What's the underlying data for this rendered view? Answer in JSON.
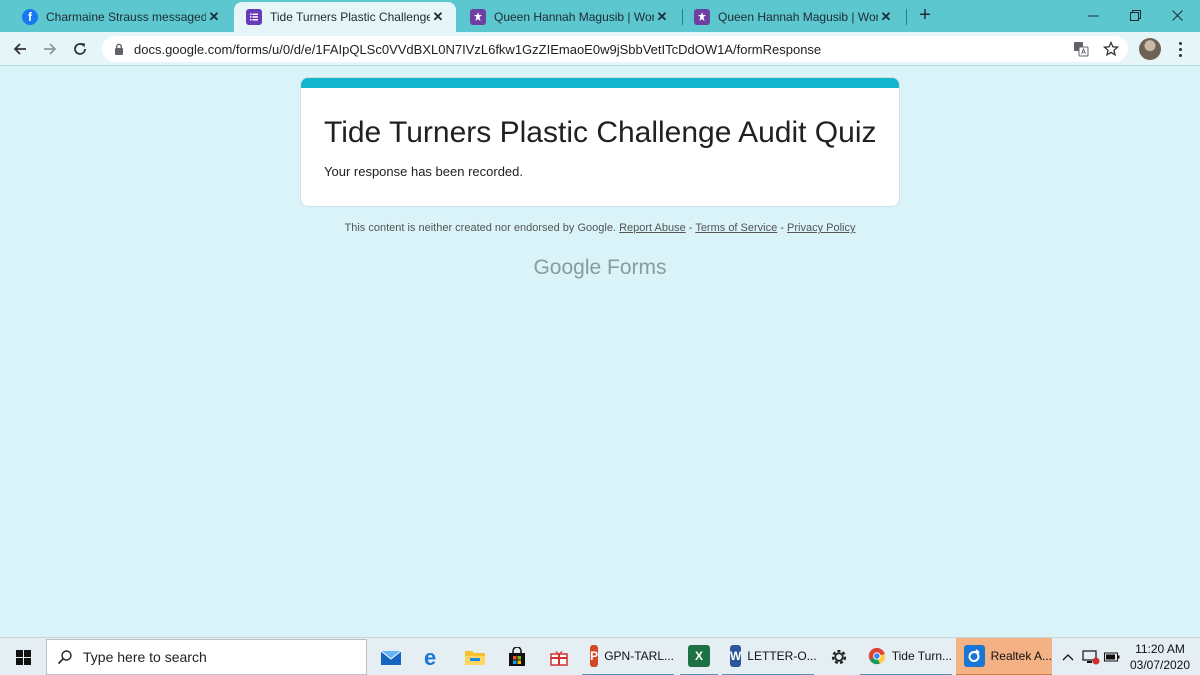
{
  "browser": {
    "tabs": [
      {
        "title": "Charmaine Strauss messaged GS",
        "favicon": "facebook-icon"
      },
      {
        "title": "Tide Turners Plastic Challenge Au",
        "favicon": "google-forms-icon"
      },
      {
        "title": "Queen Hannah Magusib | World",
        "favicon": "scout-emblem-icon"
      },
      {
        "title": "Queen Hannah Magusib | World",
        "favicon": "scout-emblem-icon"
      }
    ],
    "url": "docs.google.com/forms/u/0/d/e/1FAIpQLSc0VVdBXL0N7IVzL6fkw1GzZIEmaoE0w9jSbbVetITcDdOW1A/formResponse"
  },
  "form": {
    "title": "Tide Turners Plastic Challenge Audit Quiz",
    "confirmation": "Your response has been recorded."
  },
  "footer": {
    "disclaimer": "This content is neither created nor endorsed by Google.",
    "report_abuse": "Report Abuse",
    "sep1": "-",
    "terms": "Terms of Service",
    "sep2": "-",
    "privacy": "Privacy Policy",
    "brand_google": "Google",
    "brand_forms": "Forms"
  },
  "taskbar": {
    "search_placeholder": "Type here to search",
    "apps": {
      "powerpoint": "GPN-TARL...",
      "word": "LETTER-O...",
      "chrome": "Tide Turn...",
      "realtek": "Realtek A..."
    },
    "clock_time": "11:20 AM",
    "clock_date": "03/07/2020"
  },
  "colors": {
    "accent": "#12b5cb",
    "page_bg": "#d9f3f8",
    "tabstrip": "#5cc7cf"
  }
}
